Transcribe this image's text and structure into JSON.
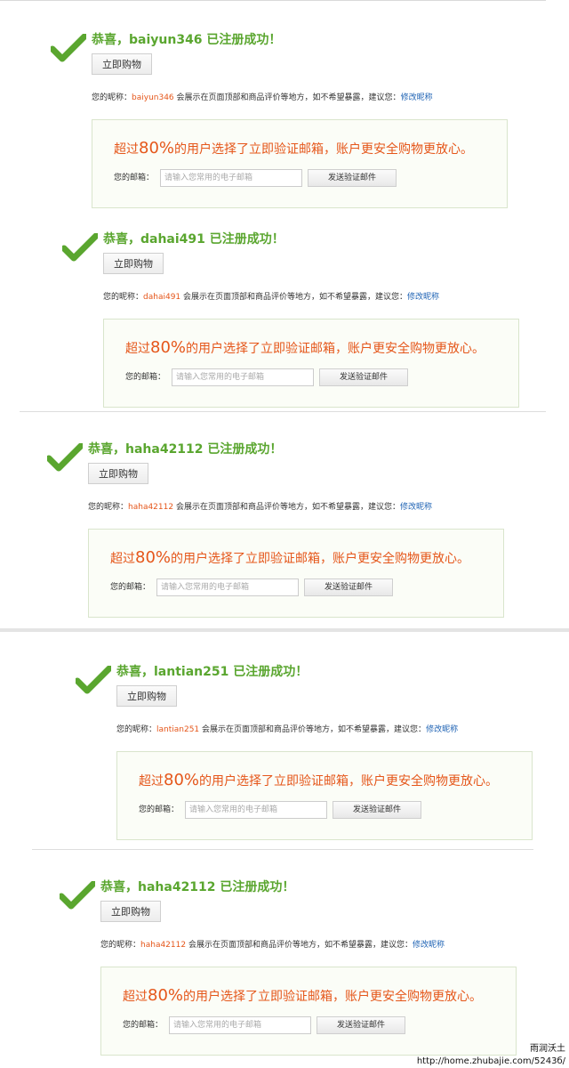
{
  "colors": {
    "title_green": "#5aa62f",
    "accent_orange": "#e5561a",
    "link_blue": "#1f63b4",
    "box_border": "#d9e5cc",
    "box_bg": "#fbfdf7"
  },
  "icons": {
    "success": "green-check-icon"
  },
  "panels": [
    {
      "title": "恭喜，baiyun346 已注册成功！",
      "buy_button": "立即购物",
      "nick_prefix": "您的昵称：",
      "nickname": "baiyun346",
      "nick_suffix": "会展示在页面顶部和商品评价等地方，如不希望暴露，建议您：",
      "edit_link": "修改昵称",
      "promo_prefix": "超过",
      "promo_percent": "80%",
      "promo_suffix": "的用户选择了立即验证邮箱，账户更安全购物更放心。",
      "email_label": "您的邮箱：",
      "email_placeholder": "请输入您常用的电子邮箱",
      "send_button": "发送验证邮件"
    },
    {
      "title": "恭喜，dahai491 已注册成功！",
      "buy_button": "立即购物",
      "nick_prefix": "您的昵称：",
      "nickname": "dahai491",
      "nick_suffix": "会展示在页面顶部和商品评价等地方，如不希望暴露，建议您：",
      "edit_link": "修改昵称",
      "promo_prefix": "超过",
      "promo_percent": "80%",
      "promo_suffix": "的用户选择了立即验证邮箱，账户更安全购物更放心。",
      "email_label": "您的邮箱：",
      "email_placeholder": "请输入您常用的电子邮箱",
      "send_button": "发送验证邮件"
    },
    {
      "title": "恭喜，haha42112 已注册成功！",
      "buy_button": "立即购物",
      "nick_prefix": "您的昵称：",
      "nickname": "haha42112",
      "nick_suffix": "会展示在页面顶部和商品评价等地方，如不希望暴露，建议您：",
      "edit_link": "修改昵称",
      "promo_prefix": "超过",
      "promo_percent": "80%",
      "promo_suffix": "的用户选择了立即验证邮箱，账户更安全购物更放心。",
      "email_label": "您的邮箱：",
      "email_placeholder": "请输入您常用的电子邮箱",
      "send_button": "发送验证邮件"
    },
    {
      "title": "恭喜，lantian251 已注册成功！",
      "buy_button": "立即购物",
      "nick_prefix": "您的昵称：",
      "nickname": "lantian251",
      "nick_suffix": "会展示在页面顶部和商品评价等地方，如不希望暴露，建议您：",
      "edit_link": "修改昵称",
      "promo_prefix": "超过",
      "promo_percent": "80%",
      "promo_suffix": "的用户选择了立即验证邮箱，账户更安全购物更放心。",
      "email_label": "您的邮箱：",
      "email_placeholder": "请输入您常用的电子邮箱",
      "send_button": "发送验证邮件"
    },
    {
      "title": "恭喜，haha42112 已注册成功！",
      "buy_button": "立即购物",
      "nick_prefix": "您的昵称：",
      "nickname": "haha42112",
      "nick_suffix": "会展示在页面顶部和商品评价等地方，如不希望暴露，建议您：",
      "edit_link": "修改昵称",
      "promo_prefix": "超过",
      "promo_percent": "80%",
      "promo_suffix": "的用户选择了立即验证邮箱，账户更安全购物更放心。",
      "email_label": "您的邮箱：",
      "email_placeholder": "请输入您常用的电子邮箱",
      "send_button": "发送验证邮件"
    }
  ],
  "watermark": {
    "line1": "雨润沃土",
    "line2": "http://home.zhubajie.com/5243б/"
  }
}
